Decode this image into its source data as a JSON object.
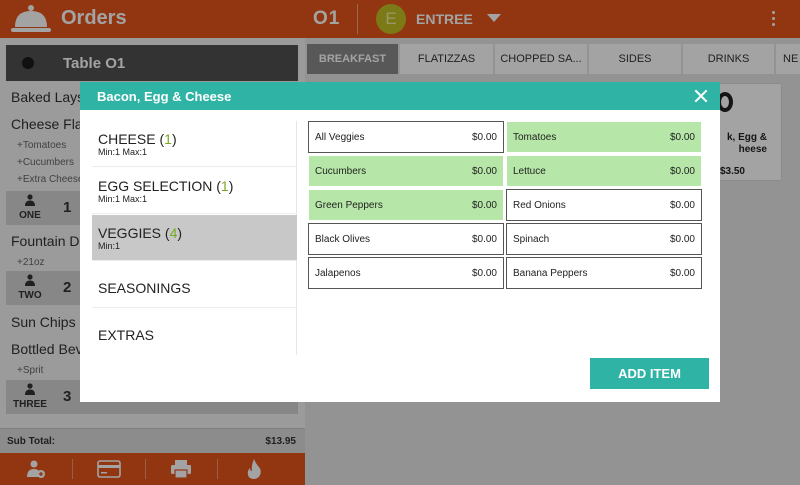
{
  "header": {
    "title": "Orders",
    "order_number": "O1",
    "course_initial": "E",
    "course_label": "ENTREE",
    "logo_icon": "cloche-icon",
    "menu_icon": "more-vert-icon",
    "accent_color": "#e5551c"
  },
  "ticket": {
    "table_label": "Table O1",
    "items": [
      {
        "name": "Baked Lays"
      },
      {
        "name": "Cheese Flat"
      },
      {
        "name": "Fountain Dri"
      },
      {
        "name": "Sun Chips"
      },
      {
        "name": "Bottled Bev"
      }
    ],
    "modifiers": [
      "+Tomatoes",
      "+Cucumbers",
      "+Extra Cheese",
      "+21oz",
      "+Sprit"
    ],
    "seats": [
      {
        "label": "ONE",
        "qty": "1"
      },
      {
        "label": "TWO",
        "qty": "2"
      },
      {
        "label": "THREE",
        "qty": "3"
      }
    ],
    "subtotal_label": "Sub Total:",
    "subtotal_value": "$13.95",
    "actions": [
      "add-customer-icon",
      "credit-card-icon",
      "printer-icon",
      "fire-icon"
    ]
  },
  "categories": {
    "tabs": [
      "BREAKFAST",
      "FLATIZZAS",
      "CHOPPED SA...",
      "SIDES",
      "DRINKS",
      "NE"
    ],
    "active_index": 0
  },
  "menu_card": {
    "name_line1": "k, Egg &",
    "name_line2": "heese",
    "price": "$3.50"
  },
  "dialog": {
    "title": "Bacon, Egg & Cheese",
    "header_color": "#2fb3a5",
    "categories": [
      {
        "name": "CHEESE",
        "count": "1",
        "limits": "Min:1 Max:1",
        "selected": false
      },
      {
        "name": "EGG SELECTION",
        "count": "1",
        "limits": "Min:1 Max:1",
        "selected": false
      },
      {
        "name": "VEGGIES",
        "count": "4",
        "limits": "Min:1",
        "selected": true
      },
      {
        "name": "SEASONINGS",
        "count": "",
        "limits": "",
        "selected": false
      },
      {
        "name": "EXTRAS",
        "count": "",
        "limits": "",
        "selected": false
      }
    ],
    "options": [
      {
        "name": "All Veggies",
        "price": "$0.00",
        "selected": false
      },
      {
        "name": "Tomatoes",
        "price": "$0.00",
        "selected": true
      },
      {
        "name": "Cucumbers",
        "price": "$0.00",
        "selected": true
      },
      {
        "name": "Lettuce",
        "price": "$0.00",
        "selected": true
      },
      {
        "name": "Green Peppers",
        "price": "$0.00",
        "selected": true
      },
      {
        "name": "Red Onions",
        "price": "$0.00",
        "selected": false
      },
      {
        "name": "Black Olives",
        "price": "$0.00",
        "selected": false
      },
      {
        "name": "Spinach",
        "price": "$0.00",
        "selected": false
      },
      {
        "name": "Jalapenos",
        "price": "$0.00",
        "selected": false
      },
      {
        "name": "Banana Peppers",
        "price": "$0.00",
        "selected": false
      }
    ],
    "selected_color": "#b6e7a8",
    "add_button": "ADD ITEM"
  }
}
